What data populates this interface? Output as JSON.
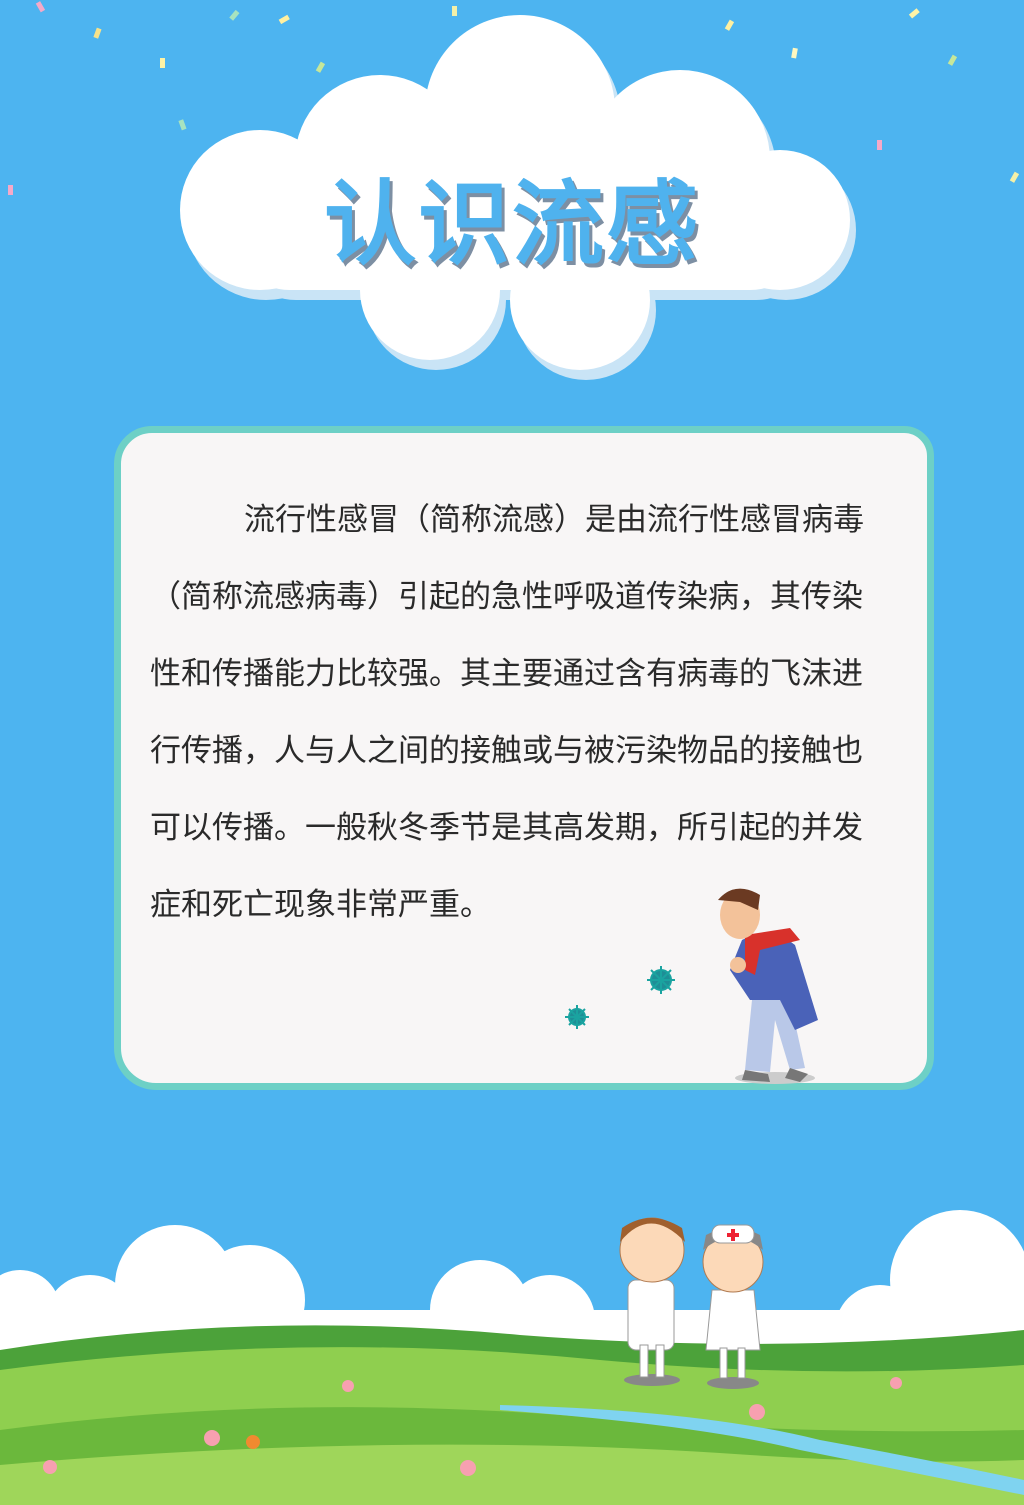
{
  "poster": {
    "title": "认识流感",
    "paragraph_lines": [
      "流行性感冒（简称流感）是由流行性感冒病毒",
      "（简称流感病毒）引起的急性呼吸道传染病，其传染",
      "性和传播能力比较强。其主要通过含有病毒的飞沫进",
      "行传播，人与人之间的接触或与被污染物品的接触也",
      "可以传播。一般秋冬季节是其高发期，所引起的并发",
      "症和死亡现象非常严重。"
    ]
  },
  "colors": {
    "sky": "#4db4f0",
    "title": "#4fb2ee",
    "card_border": "#6dd0c6",
    "card_fill": "#f8f6f6",
    "grass": "#7cc44a"
  },
  "illustrations": [
    "confetti",
    "title-cloud",
    "sneezing-man",
    "virus-icon",
    "doctor-and-nurse",
    "grass-hills",
    "flowers",
    "stream"
  ]
}
